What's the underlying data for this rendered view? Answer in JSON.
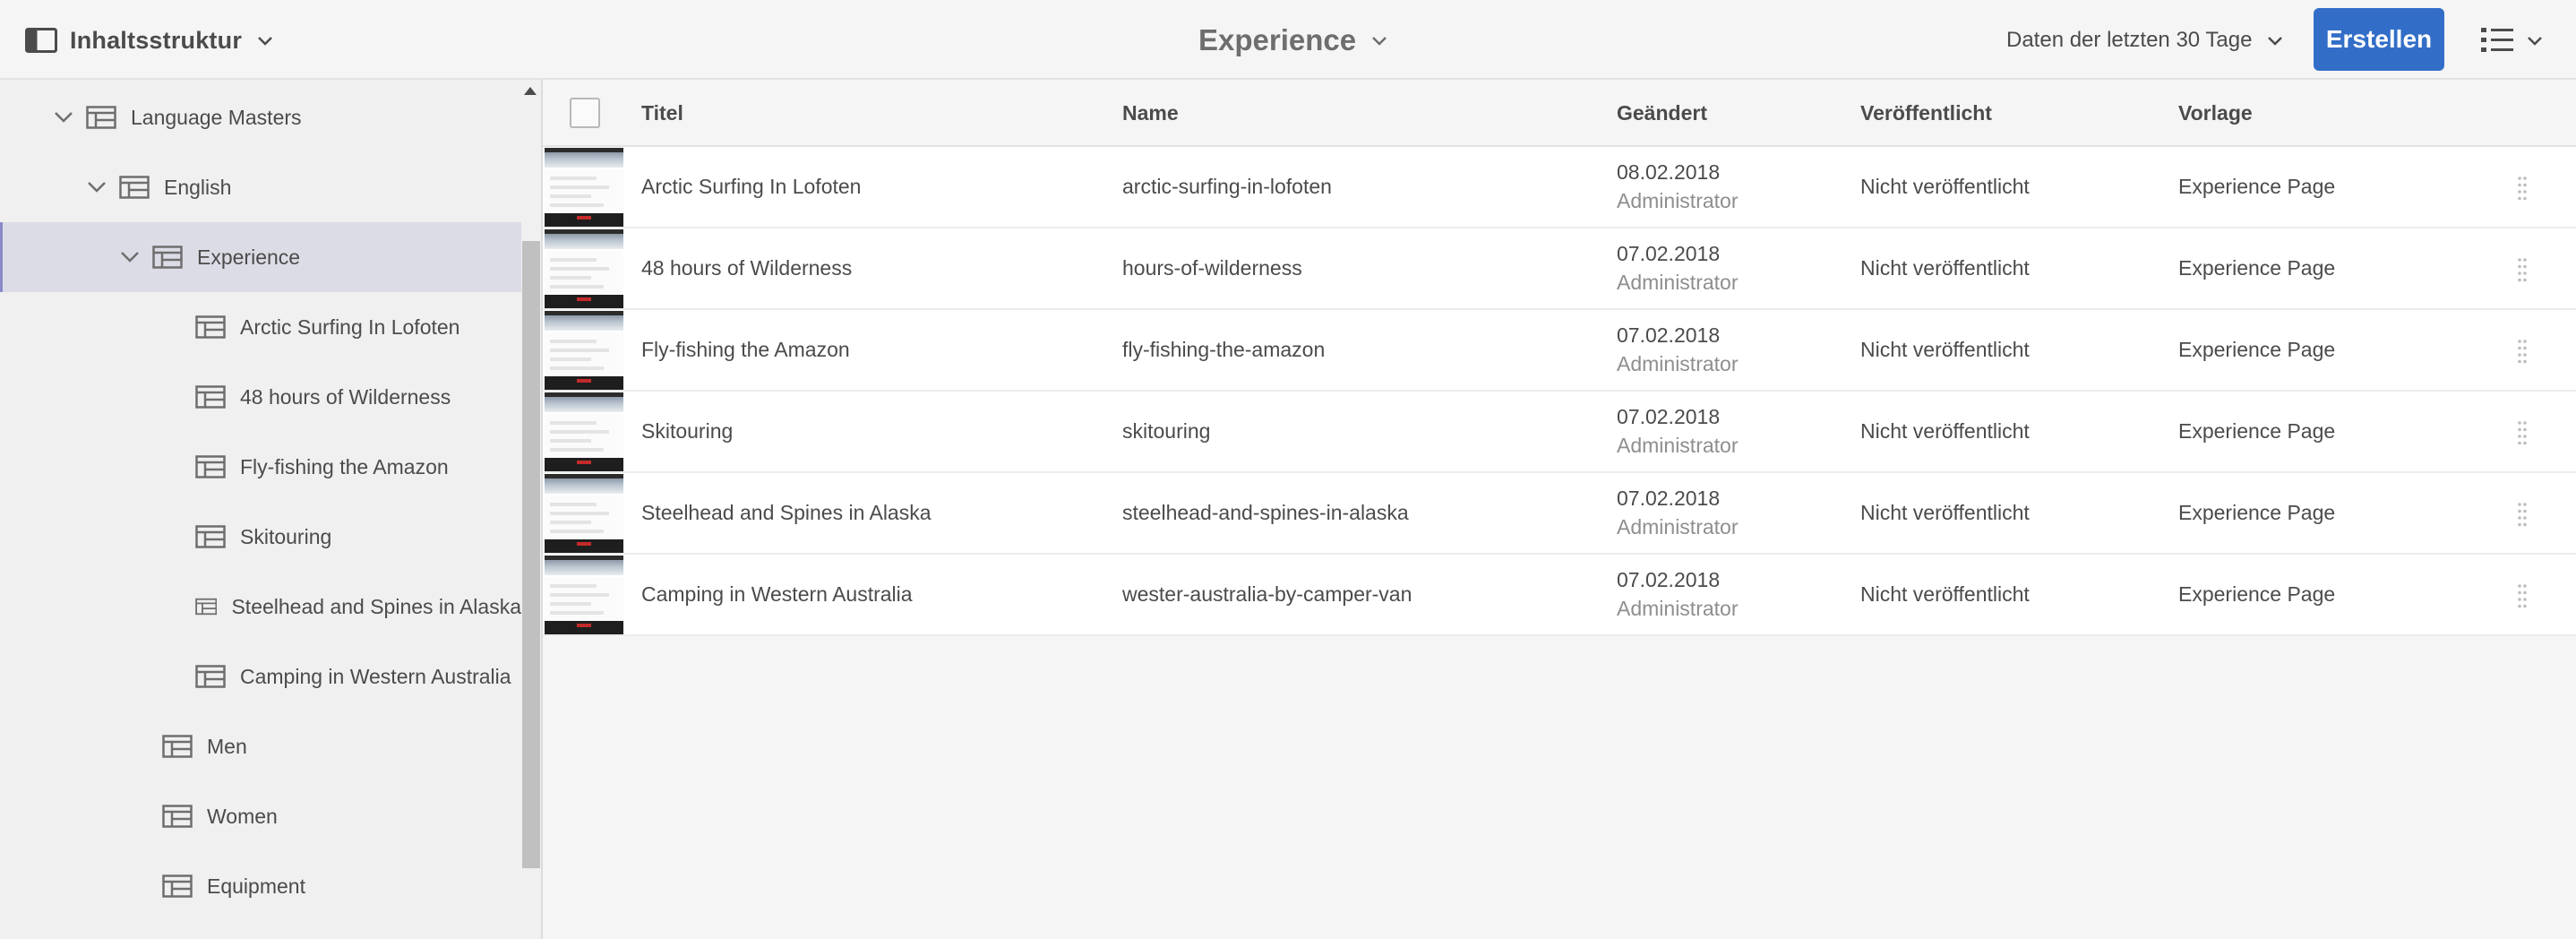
{
  "header": {
    "rail_label": "Inhaltsstruktur",
    "title": "Experience",
    "filter_label": "Daten der letzten 30 Tage",
    "create_label": "Erstellen",
    "view_icon": "list-view-icon"
  },
  "rail": {
    "items": [
      {
        "label": "Language Masters",
        "expanded": true
      },
      {
        "label": "English",
        "expanded": true
      },
      {
        "label": "Experience",
        "expanded": true,
        "selected": true
      },
      {
        "label": "Arctic Surfing In Lofoten"
      },
      {
        "label": "48 hours of Wilderness"
      },
      {
        "label": "Fly-fishing the Amazon"
      },
      {
        "label": "Skitouring"
      },
      {
        "label": "Steelhead and Spines in Alaska"
      },
      {
        "label": "Camping in Western Australia"
      },
      {
        "label": "Men"
      },
      {
        "label": "Women"
      },
      {
        "label": "Equipment"
      }
    ]
  },
  "table": {
    "columns": [
      "Titel",
      "Name",
      "Geändert",
      "Veröffentlicht",
      "Vorlage"
    ],
    "rows": [
      {
        "title": "Arctic Surfing In Lofoten",
        "name": "arctic-surfing-in-lofoten",
        "modified_date": "08.02.2018",
        "modified_by": "Administrator",
        "published": "Nicht veröffentlicht",
        "template": "Experience Page"
      },
      {
        "title": "48 hours of Wilderness",
        "name": "hours-of-wilderness",
        "modified_date": "07.02.2018",
        "modified_by": "Administrator",
        "published": "Nicht veröffentlicht",
        "template": "Experience Page"
      },
      {
        "title": "Fly-fishing the Amazon",
        "name": "fly-fishing-the-amazon",
        "modified_date": "07.02.2018",
        "modified_by": "Administrator",
        "published": "Nicht veröffentlicht",
        "template": "Experience Page"
      },
      {
        "title": "Skitouring",
        "name": "skitouring",
        "modified_date": "07.02.2018",
        "modified_by": "Administrator",
        "published": "Nicht veröffentlicht",
        "template": "Experience Page"
      },
      {
        "title": "Steelhead and Spines in Alaska",
        "name": "steelhead-and-spines-in-alaska",
        "modified_date": "07.02.2018",
        "modified_by": "Administrator",
        "published": "Nicht veröffentlicht",
        "template": "Experience Page"
      },
      {
        "title": "Camping in Western Australia",
        "name": "wester-australia-by-camper-van",
        "modified_date": "07.02.2018",
        "modified_by": "Administrator",
        "published": "Nicht veröffentlicht",
        "template": "Experience Page"
      }
    ]
  },
  "colors": {
    "accent": "#326ec8",
    "selected_bg": "#dcdce6",
    "rail_bg": "#f0f0f0",
    "row_bg": "#ffffff"
  }
}
